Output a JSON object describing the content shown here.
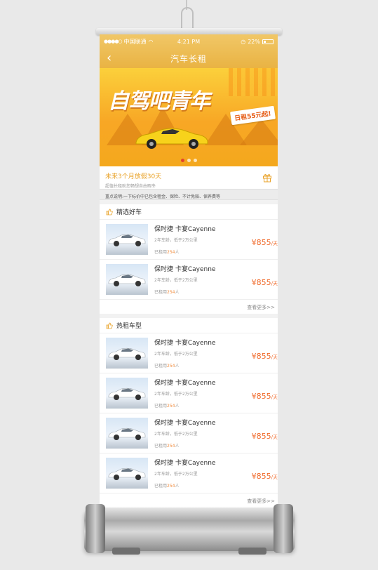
{
  "statusbar": {
    "carrier": "中国联通",
    "time": "4:21 PM",
    "battery": "22%"
  },
  "navbar": {
    "title": "汽车长租"
  },
  "banner": {
    "title": "自驾吧青年",
    "tag": "日租55元起!"
  },
  "promo": {
    "title": "未来3个月放假30天",
    "subtitle": "超值长租助您畅想自由暇冬"
  },
  "notice": "重点说明:一下标价中已包含租金、保险、不计免赔、保养费等",
  "sections": [
    {
      "title": "精选好车",
      "more": "查看更多>>",
      "items": [
        {
          "name": "保时捷 卡宴Cayenne",
          "desc": "2年车龄，低于2万公里",
          "rented_prefix": "已租用",
          "rented_count": "254",
          "rented_suffix": "人",
          "price": "¥855",
          "unit": "/天"
        },
        {
          "name": "保时捷 卡宴Cayenne",
          "desc": "2年车龄，低于2万公里",
          "rented_prefix": "已租用",
          "rented_count": "254",
          "rented_suffix": "人",
          "price": "¥855",
          "unit": "/天"
        }
      ]
    },
    {
      "title": "热租车型",
      "more": "查看更多>>",
      "items": [
        {
          "name": "保时捷 卡宴Cayenne",
          "desc": "2年车龄，低于2万公里",
          "rented_prefix": "已租用",
          "rented_count": "254",
          "rented_suffix": "人",
          "price": "¥855",
          "unit": "/天"
        },
        {
          "name": "保时捷 卡宴Cayenne",
          "desc": "2年车龄，低于2万公里",
          "rented_prefix": "已租用",
          "rented_count": "254",
          "rented_suffix": "人",
          "price": "¥855",
          "unit": "/天"
        },
        {
          "name": "保时捷 卡宴Cayenne",
          "desc": "2年车龄，低于2万公里",
          "rented_prefix": "已租用",
          "rented_count": "254",
          "rented_suffix": "人",
          "price": "¥855",
          "unit": "/天"
        },
        {
          "name": "保时捷 卡宴Cayenne",
          "desc": "2年车龄，低于2万公里",
          "rented_prefix": "已租用",
          "rented_count": "254",
          "rented_suffix": "人",
          "price": "¥855",
          "unit": "/天"
        }
      ]
    }
  ],
  "colors": {
    "accent": "#e9b343",
    "price": "#f06a2a"
  }
}
